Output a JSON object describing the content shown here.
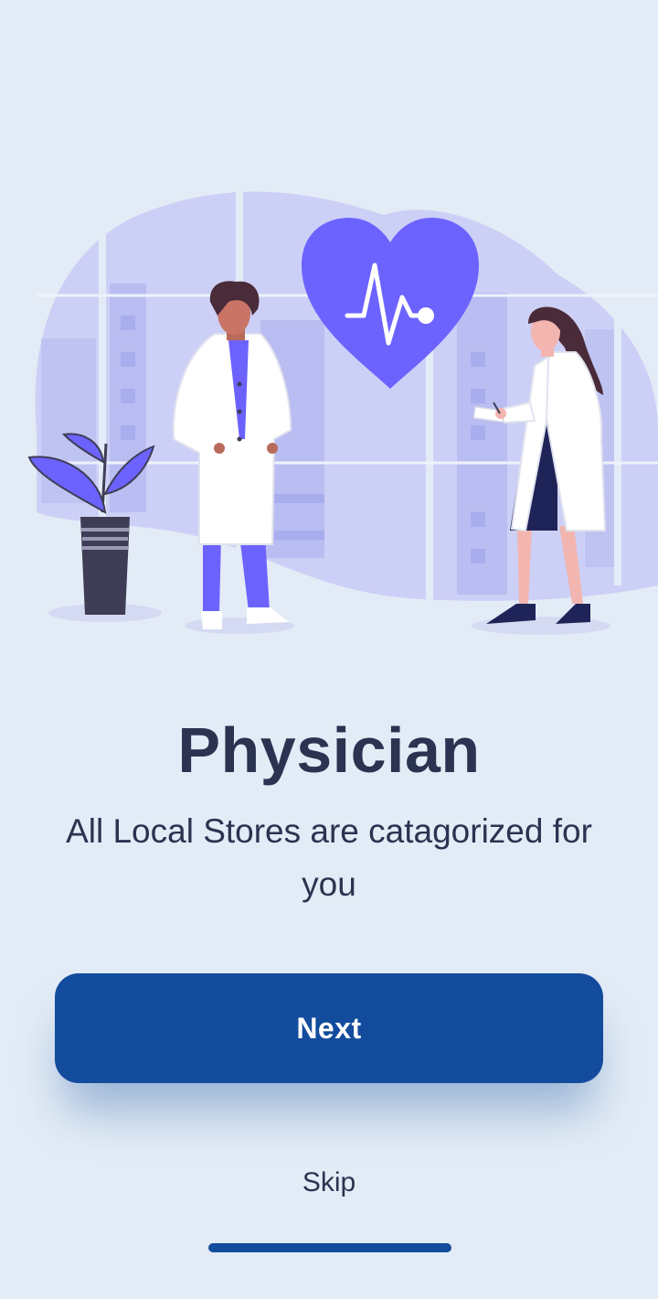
{
  "onboarding": {
    "title": "Physician",
    "subtitle": "All Local Stores are catagorized for you",
    "next_label": "Next",
    "skip_label": "Skip"
  },
  "illustration": {
    "subject": "two-doctors-with-heart-icon",
    "colors": {
      "accent": "#6c63ff",
      "blob": "#cdd0f6",
      "lab_coat": "#ffffff",
      "dark": "#3f3d56"
    }
  },
  "colors": {
    "background": "#e3ecf6",
    "primary": "#134c9c",
    "text": "#2a3350"
  }
}
